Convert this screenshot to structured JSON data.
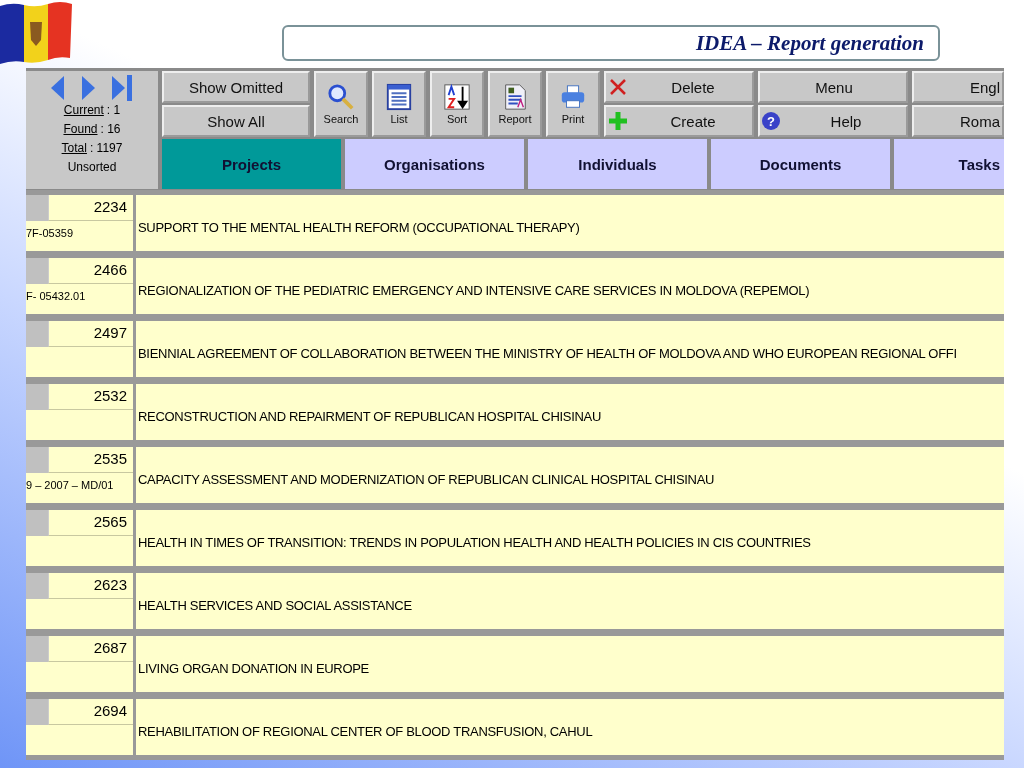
{
  "slide_title": "IDEA – Report generation",
  "record_nav": {
    "counts": [
      {
        "label": "Current",
        "value": ": 1"
      },
      {
        "label": "Found",
        "value": ": 16"
      },
      {
        "label": "Total",
        "value": ": 1197"
      }
    ],
    "sort_state": "Unsorted"
  },
  "text_buttons": [
    {
      "label": "Show Omitted"
    },
    {
      "label": "Show All"
    }
  ],
  "icon_buttons": [
    {
      "kind": "search",
      "label": "Search"
    },
    {
      "kind": "list",
      "label": "List"
    },
    {
      "kind": "sort",
      "label": "Sort"
    },
    {
      "kind": "report",
      "label": "Report"
    },
    {
      "kind": "print",
      "label": "Print"
    }
  ],
  "action_buttons": [
    {
      "kind": "delete",
      "label": "Delete"
    },
    {
      "kind": "plain",
      "label": "Menu"
    },
    {
      "kind": "create",
      "label": "Create"
    },
    {
      "kind": "help",
      "label": "Help",
      "icon_text": "?"
    }
  ],
  "language_buttons": [
    {
      "label": "Engl"
    },
    {
      "label": "Roma"
    }
  ],
  "tabs": [
    {
      "label": "Projects",
      "selected": true
    },
    {
      "label": "Organisations",
      "selected": false
    },
    {
      "label": "Individuals",
      "selected": false
    },
    {
      "label": "Documents",
      "selected": false
    },
    {
      "label": "Tasks",
      "selected": false
    }
  ],
  "rows": [
    {
      "id": "2234",
      "code": "7F-05359",
      "title": "SUPPORT TO THE MENTAL HEALTH REFORM (OCCUPATIONAL THERAPY)"
    },
    {
      "id": "2466",
      "code": "F- 05432.01",
      "title": "REGIONALIZATION OF THE PEDIATRIC EMERGENCY AND INTENSIVE CARE SERVICES IN MOLDOVA (REPEMOL)"
    },
    {
      "id": "2497",
      "title": "BIENNIAL AGREEMENT OF COLLABORATION BETWEEN THE MINISTRY OF HEALTH OF MOLDOVA AND WHO EUROPEAN REGIONAL OFFI"
    },
    {
      "id": "2532",
      "title": "RECONSTRUCTION AND REPAIRMENT OF REPUBLICAN HOSPITAL CHISINAU"
    },
    {
      "id": "2535",
      "code": "9 – 2007 – MD/01",
      "title": "CAPACITY ASSESSMENT  AND MODERNIZATION OF  REPUBLICAN CLINICAL HOSPITAL CHISINAU"
    },
    {
      "id": "2565",
      "title": "HEALTH IN TIMES OF TRANSITION: TRENDS IN POPULATION HEALTH AND HEALTH POLICIES IN CIS COUNTRIES"
    },
    {
      "id": "2623",
      "title": "HEALTH SERVICES AND SOCIAL ASSISTANCE"
    },
    {
      "id": "2687",
      "title": "LIVING ORGAN DONATION IN EUROPE"
    },
    {
      "id": "2694",
      "title": "REHABILITATION OF REGIONAL CENTER OF BLOOD TRANSFUSION, CAHUL"
    }
  ]
}
